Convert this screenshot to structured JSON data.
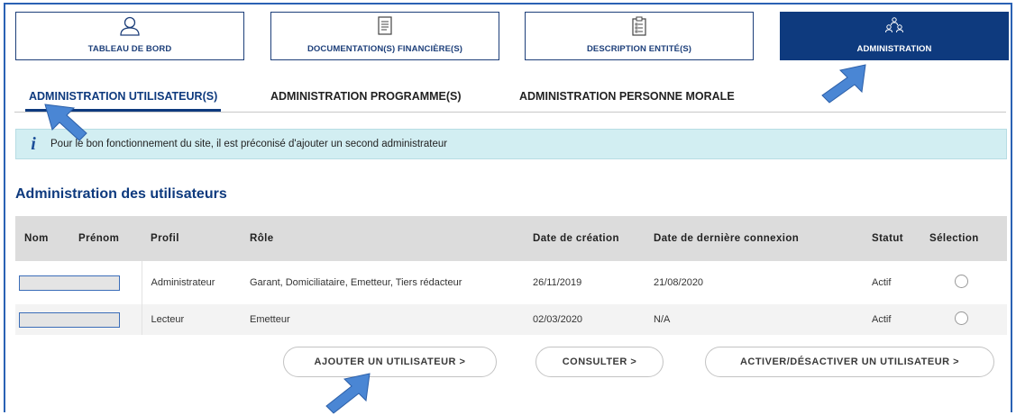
{
  "tiles": [
    {
      "label": "TABLEAU DE BORD",
      "icon": "user-icon"
    },
    {
      "label": "DOCUMENTATION(S) FINANCIÈRE(S)",
      "icon": "document-icon"
    },
    {
      "label": "DESCRIPTION ENTITÉ(S)",
      "icon": "clipboard-icon"
    },
    {
      "label": "ADMINISTRATION",
      "icon": "group-icon"
    }
  ],
  "subtabs": [
    {
      "label": "ADMINISTRATION UTILISATEUR(S)"
    },
    {
      "label": "ADMINISTRATION PROGRAMME(S)"
    },
    {
      "label": "ADMINISTRATION PERSONNE MORALE"
    }
  ],
  "info": {
    "icon_text": "i",
    "message": "Pour le bon fonctionnement du site, il est préconisé d'ajouter un second administrateur"
  },
  "section_title": "Administration des utilisateurs",
  "table": {
    "headers": [
      "Nom",
      "Prénom",
      "Profil",
      "Rôle",
      "Date de création",
      "Date de dernière connexion",
      "Statut",
      "Sélection"
    ],
    "rows": [
      {
        "profil": "Administrateur",
        "role": "Garant, Domiciliataire, Emetteur, Tiers rédacteur",
        "creation": "26/11/2019",
        "connexion": "21/08/2020",
        "statut": "Actif"
      },
      {
        "profil": "Lecteur",
        "role": "Emetteur",
        "creation": "02/03/2020",
        "connexion": "N/A",
        "statut": "Actif"
      }
    ]
  },
  "buttons": {
    "add": "AJOUTER UN UTILISATEUR  >",
    "consult": "CONSULTER  >",
    "toggle": "ACTIVER/DÉSACTIVER UN UTILISATEUR  >"
  },
  "colors": {
    "primary": "#0e3a7e",
    "info_bg": "#d2eef2",
    "header_bg": "#dcdcdc",
    "arrow": "#4a86d4"
  }
}
